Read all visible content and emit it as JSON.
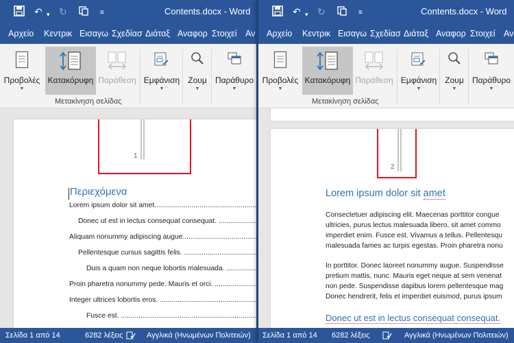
{
  "windows": [
    {
      "id": "left",
      "title": "Contents.docx  -  Word",
      "tabs": [
        "Αρχείο",
        "Κεντρικ",
        "Εισαγω",
        "Σχεδίασ",
        "Διάταξ",
        "Αναφορ",
        "Στοιχεί",
        "Αν"
      ],
      "ribbon": {
        "views": "Προβολές",
        "vertical": "Κατακόρυφη",
        "side_by_side": "Παράθεση",
        "show": "Εμφάνιση",
        "zoom": "Ζουμ",
        "window": "Παράθυρο",
        "group_label": "Μετακίνηση σελίδας"
      },
      "page_number": "1",
      "toc_heading": "Περιεχόμενα",
      "toc": [
        "Lorem ipsum dolor sit amet.......................................................................",
        "Donec ut est in lectus consequat consequat. ......................................................",
        "Aliquam nonummy adipiscing augue..................................................................",
        "Pellentesque cursus sagittis felis. ...............................................................",
        "Duis a quam non neque lobortis malesuada. ........................................................",
        "Proin pharetra nonummy pede. Mauris et orci. .....................................................",
        "Integer ultrices lobortis eros. ...................................................................",
        "Fusce est. ........................................................................................"
      ],
      "status": {
        "page": "Σελίδα 1 από 14",
        "words": "6282 λέξεις",
        "language": "Αγγλικά (Ηνωμένων Πολιτειών)"
      }
    },
    {
      "id": "right",
      "title": "Contents.docx  -  Word",
      "tabs": [
        "Αρχείο",
        "Κεντρικ",
        "Εισαγω",
        "Σχεδίασ",
        "Διάταξ",
        "Αναφορ",
        "Στοιχεί",
        "Αν"
      ],
      "ribbon": {
        "views": "Προβολές",
        "vertical": "Κατακόρυφη",
        "side_by_side": "Παράθεση",
        "show": "Εμφάνιση",
        "zoom": "Ζουμ",
        "window": "Παράθυρο",
        "group_label": "Μετακίνηση σελίδας"
      },
      "page_number": "2",
      "heading1_pre": "Lorem ipsum dolor sit ",
      "heading1_err": "amet",
      "paragraphs": [
        [
          "Consectetuer adipiscing elit. Maecenas porttitor congue",
          "ultricies, purus lectus malesuada libero, sit amet commo",
          "imperdiet enim. Fusce est. Vivamus a tellus. Pellentesqu",
          "malesuada fames ac turpis egestas. Proin pharetra nonu"
        ],
        [
          "In porttitor. Donec laoreet nonummy augue. Suspendisse",
          "pretium mattis, nunc. Mauris eget neque at sem venenat",
          "non pede. Suspendisse dapibus lorem pellentesque mag",
          "Donec hendrerit, felis et imperdiet euismod, purus ipsum"
        ]
      ],
      "heading2": "Donec ut est in lectus consequat consequat.",
      "status": {
        "page": "Σελίδα 1 από 14",
        "words": "6282 λέξεις",
        "language": "Αγγλικά (Ηνωμένων Πολιτειών)"
      }
    }
  ],
  "icons": {
    "save": "save-icon",
    "undo": "undo-icon",
    "redo": "redo-icon",
    "touch": "touch-mode-icon",
    "customize": "customize-toolbar-icon",
    "proofing": "proofing-icon"
  },
  "colors": {
    "word_blue": "#2b579a",
    "heading_blue": "#2e74b5",
    "highlight_red": "#e81123",
    "active_button": "#c6c6c6"
  }
}
